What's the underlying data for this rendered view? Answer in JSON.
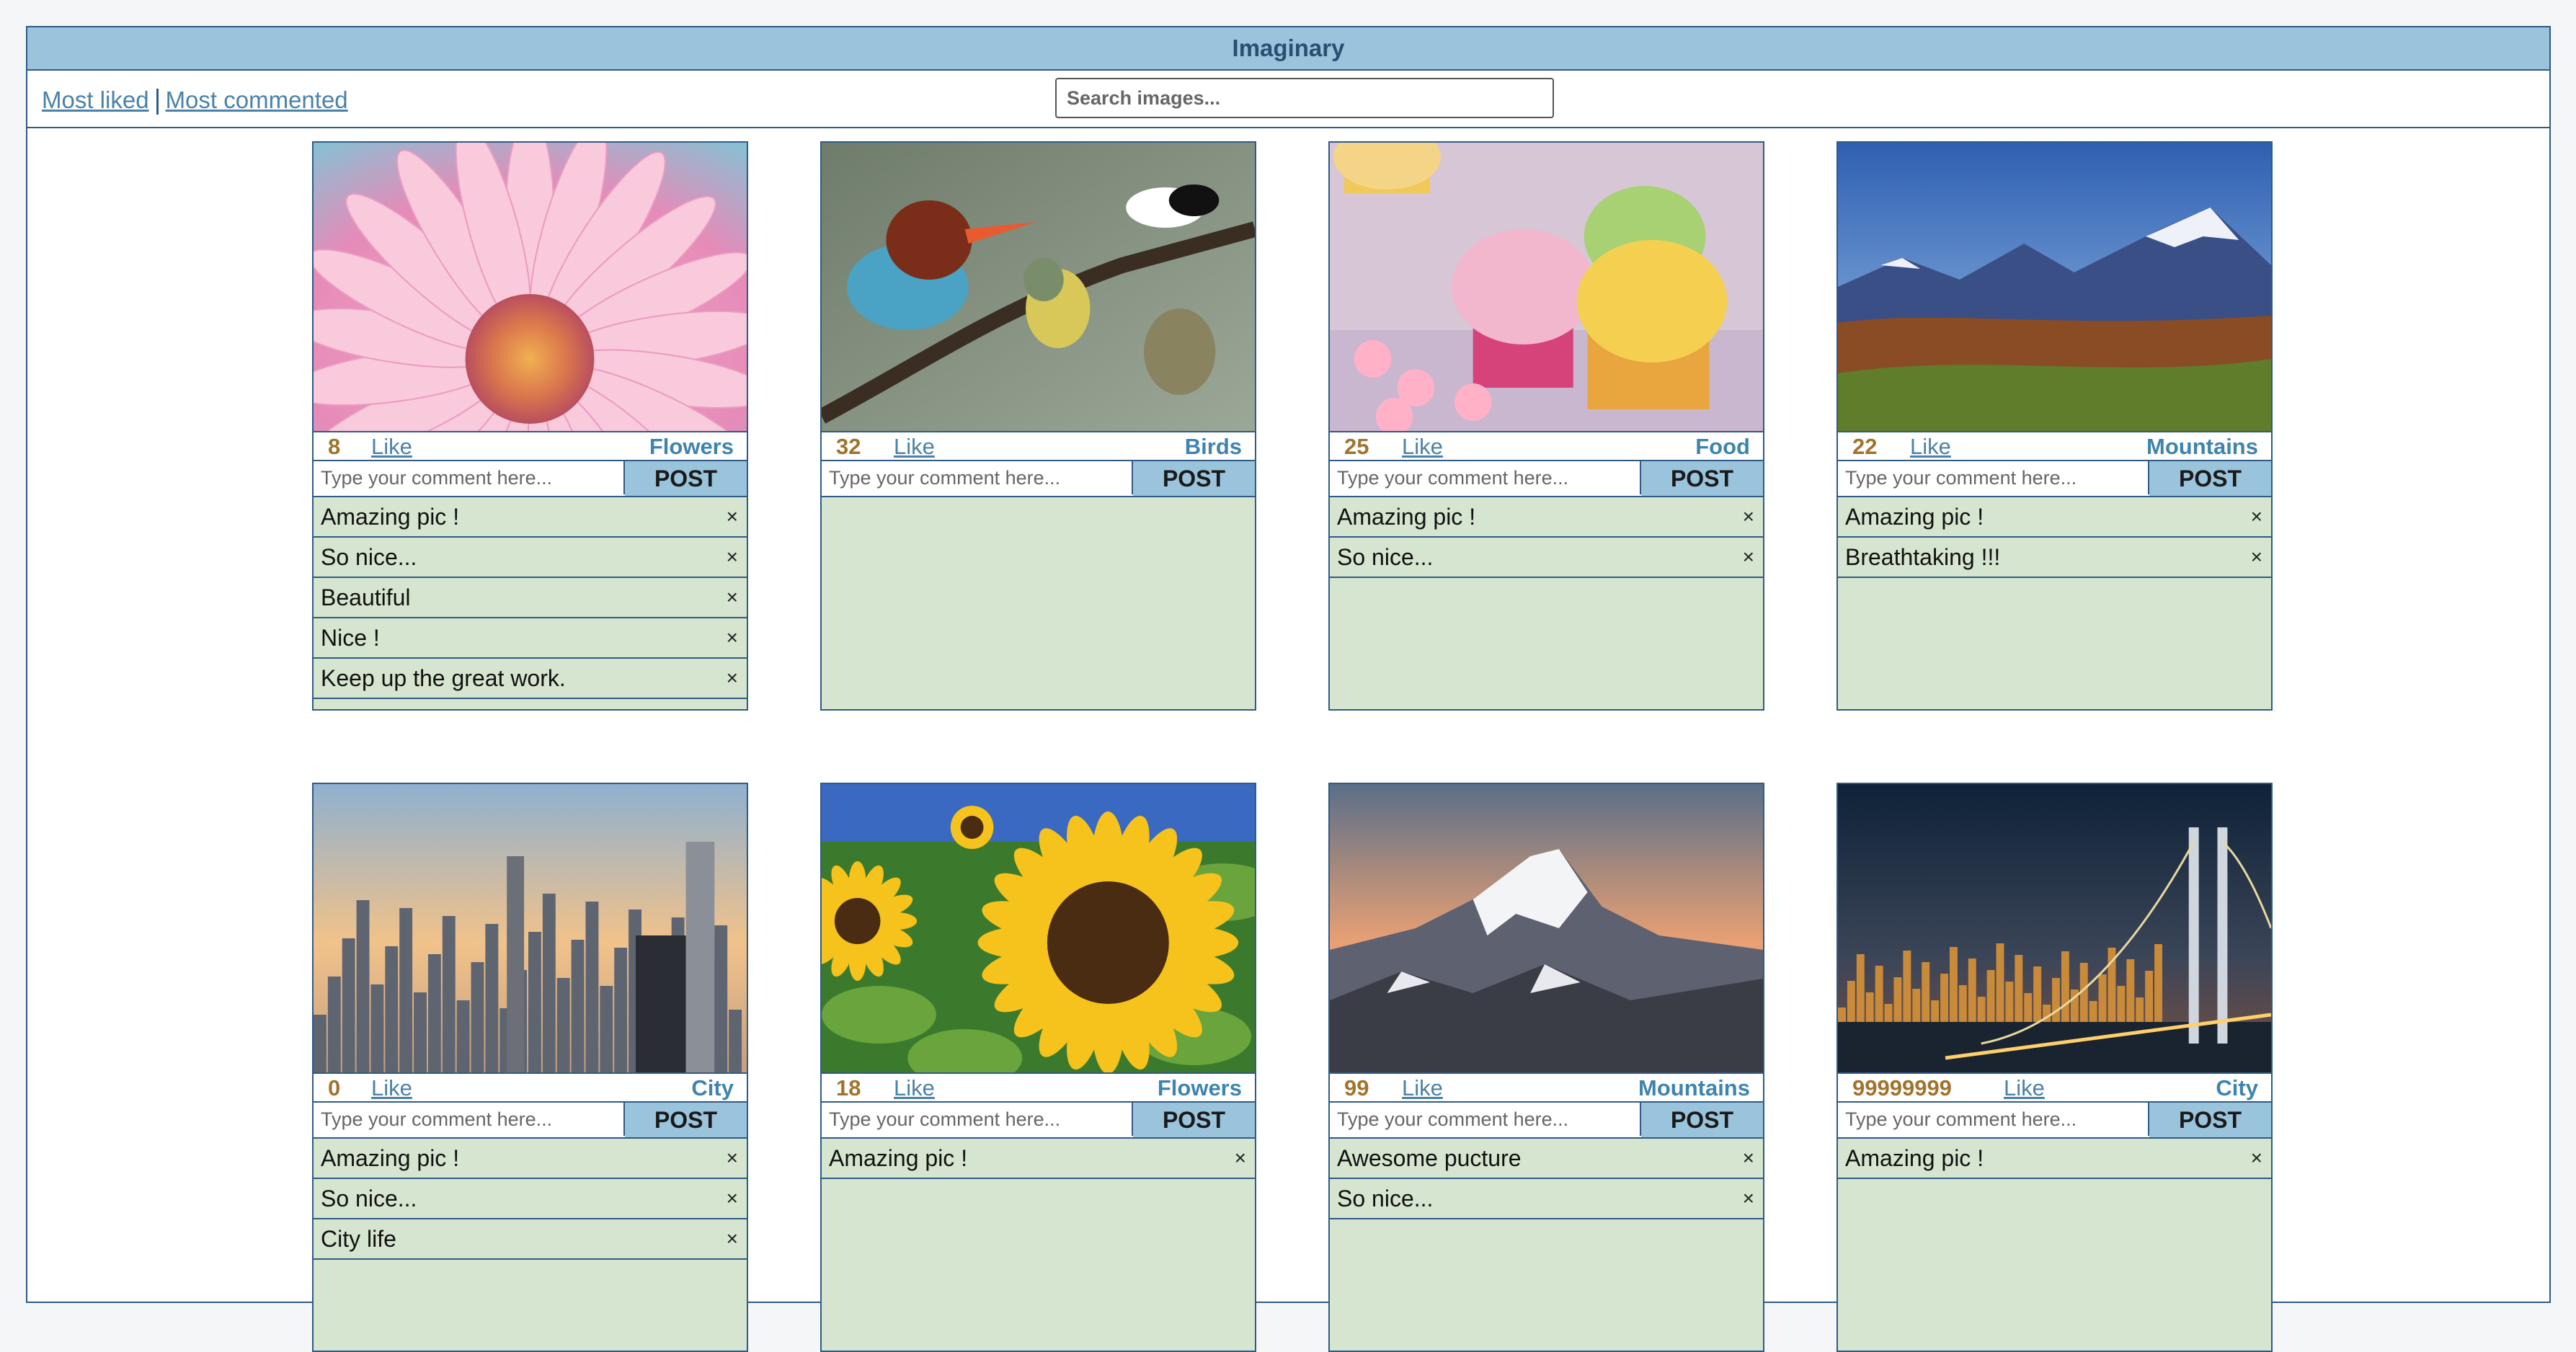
{
  "app": {
    "title": "Imaginary"
  },
  "nav": {
    "most_liked": "Most liked",
    "most_commented": "Most commented"
  },
  "search": {
    "placeholder": "Search images..."
  },
  "post_label": "POST",
  "like_label": "Like",
  "comment_placeholder": "Type your comment here...",
  "close_glyph": "×",
  "cards": [
    {
      "likes": "8",
      "category": "Flowers",
      "image": "pink-daisy-photo",
      "comments": [
        "Amazing pic !",
        "So nice...",
        "Beautiful",
        "Nice !",
        "Keep up the great work."
      ]
    },
    {
      "likes": "32",
      "category": "Birds",
      "image": "birds-on-branch-photo",
      "comments": []
    },
    {
      "likes": "25",
      "category": "Food",
      "image": "cupcakes-photo",
      "comments": [
        "Amazing pic !",
        "So nice..."
      ]
    },
    {
      "likes": "22",
      "category": "Mountains",
      "image": "mountain-landscape-photo",
      "comments": [
        "Amazing pic !",
        "Breathtaking !!!"
      ]
    },
    {
      "likes": "0",
      "category": "City",
      "image": "city-skyline-photo",
      "comments": [
        "Amazing pic !",
        "So nice...",
        "City life"
      ]
    },
    {
      "likes": "18",
      "category": "Flowers",
      "image": "sunflowers-photo",
      "comments": [
        "Amazing pic !"
      ]
    },
    {
      "likes": "99",
      "category": "Mountains",
      "image": "snowy-peak-photo",
      "comments": [
        "Awesome pucture",
        "So nice..."
      ]
    },
    {
      "likes": "99999999",
      "category": "City",
      "image": "bridge-night-photo",
      "comments": [
        "Amazing pic !"
      ]
    }
  ]
}
